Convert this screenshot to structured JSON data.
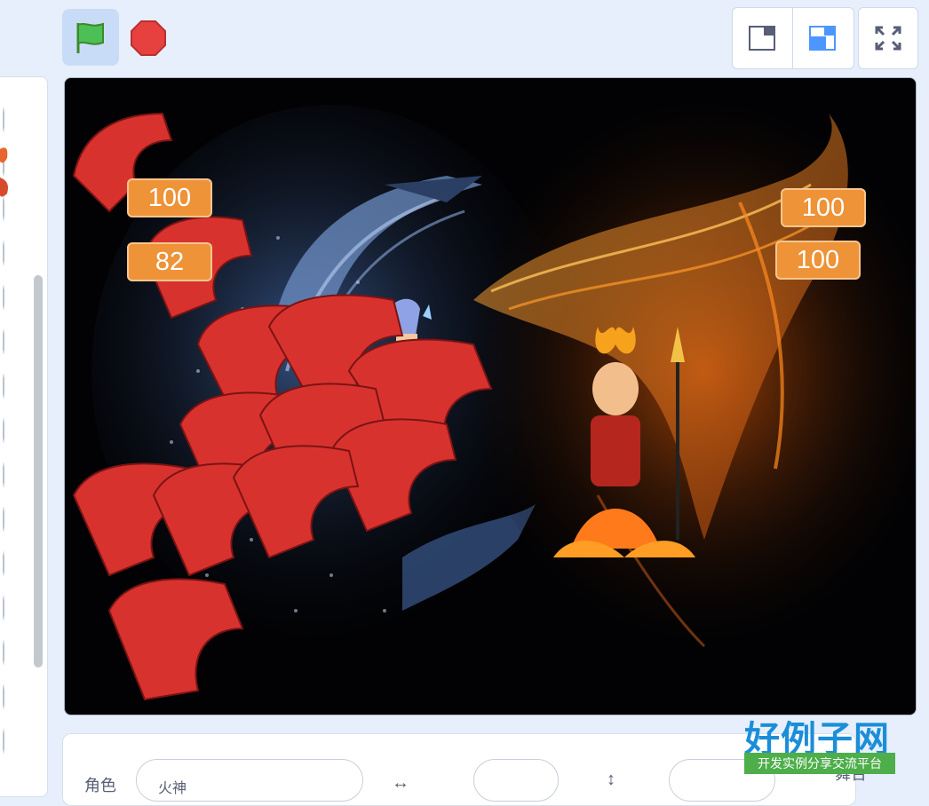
{
  "toolbar": {
    "green_flag": "green-flag-icon",
    "stop": "stop-icon",
    "small_stage": "small-stage-icon",
    "large_stage": "large-stage-icon",
    "fullscreen": "fullscreen-icon"
  },
  "stage": {
    "monitors": [
      {
        "id": "left-top",
        "value": "100"
      },
      {
        "id": "left-bottom",
        "value": "82"
      },
      {
        "id": "right-top",
        "value": "100"
      },
      {
        "id": "right-bottom",
        "value": "100"
      }
    ],
    "sprites": [
      "red-dragon-clones",
      "blue-hair-hero",
      "fire-warrior"
    ],
    "colors": {
      "monitor": "#ee9338",
      "fire": "#f08a1c",
      "water": "#6e8fc4"
    }
  },
  "sprite_info": {
    "name_label": "角色",
    "name_value": "火神",
    "stage_label": "舞台"
  },
  "watermark": {
    "title": "好例子网",
    "subtitle": "开发实例分享交流平台"
  }
}
